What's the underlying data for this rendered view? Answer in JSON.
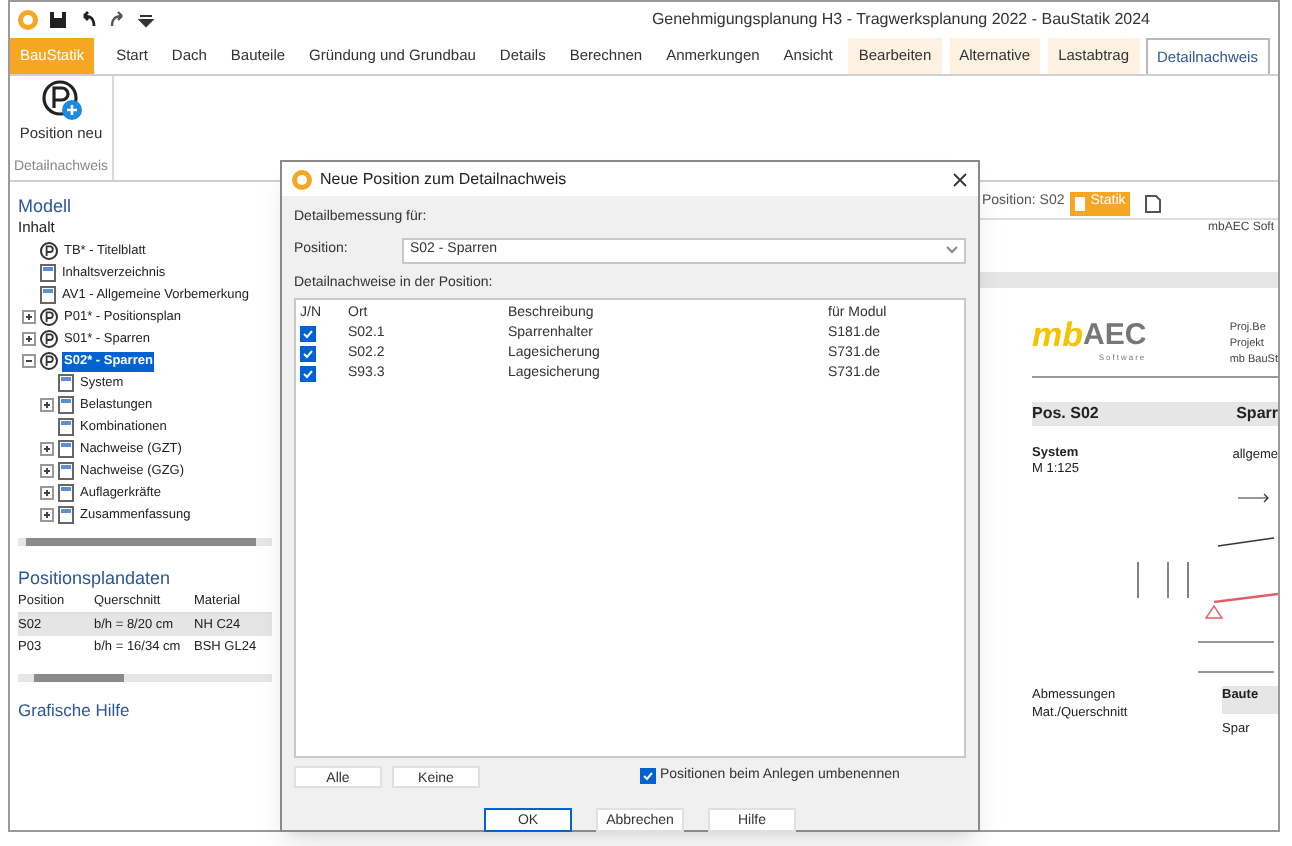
{
  "window": {
    "title": "Genehmigungsplanung H3 - Tragwerksplanung 2022 - BauStatik 2024"
  },
  "ribbon_tabs": [
    {
      "label": "BauStatik",
      "kind": "app",
      "selected": false
    },
    {
      "label": "Start",
      "kind": "normal",
      "selected": false
    },
    {
      "label": "Dach",
      "kind": "normal",
      "selected": false
    },
    {
      "label": "Bauteile",
      "kind": "normal",
      "selected": false
    },
    {
      "label": "Gründung und Grundbau",
      "kind": "normal",
      "selected": false
    },
    {
      "label": "Details",
      "kind": "normal",
      "selected": false
    },
    {
      "label": "Berechnen",
      "kind": "normal",
      "selected": false
    },
    {
      "label": "Anmerkungen",
      "kind": "normal",
      "selected": false
    },
    {
      "label": "Ansicht",
      "kind": "normal",
      "selected": false
    },
    {
      "label": "Bearbeiten",
      "kind": "contextual",
      "selected": false
    },
    {
      "label": "Alternative",
      "kind": "contextual",
      "selected": false
    },
    {
      "label": "Lastabtrag",
      "kind": "contextual",
      "selected": false
    },
    {
      "label": "Detailnachweis",
      "kind": "normal",
      "selected": true
    }
  ],
  "ribbon": {
    "buttons": [
      {
        "label": "Position neu"
      }
    ],
    "group_label": "Detailnachweis"
  },
  "model_panel": {
    "title": "Modell",
    "root": "Inhalt",
    "tree": [
      {
        "label": "TB* - Titelblatt",
        "kind": "position",
        "selected": false
      },
      {
        "label": "Inhaltsverzeichnis",
        "kind": "document",
        "selected": false
      },
      {
        "label": "AV1 - Allgemeine Vorbemerkung",
        "kind": "document",
        "selected": false
      },
      {
        "label": "P01* - Positionsplan",
        "kind": "position",
        "expanded": false,
        "selected": false
      },
      {
        "label": "S01* - Sparren",
        "kind": "position",
        "expanded": false,
        "selected": false
      },
      {
        "label": "S02* - Sparren",
        "kind": "position",
        "expanded": true,
        "selected": true,
        "children": [
          {
            "label": "System",
            "kind": "document",
            "selected": false
          },
          {
            "label": "Belastungen",
            "kind": "document",
            "expanded": false,
            "selected": false
          },
          {
            "label": "Kombinationen",
            "kind": "document",
            "selected": false
          },
          {
            "label": "Nachweise (GZT)",
            "kind": "document",
            "expanded": false,
            "selected": false
          },
          {
            "label": "Nachweise (GZG)",
            "kind": "document",
            "expanded": false,
            "selected": false
          },
          {
            "label": "Auflagerkräfte",
            "kind": "document",
            "expanded": false,
            "selected": false
          },
          {
            "label": "Zusammenfassung",
            "kind": "document",
            "expanded": false,
            "selected": false
          }
        ]
      }
    ]
  },
  "position_data": {
    "title": "Positionsplandaten",
    "columns": [
      "Position",
      "Querschnitt",
      "Material"
    ],
    "rows": [
      {
        "cells": [
          "S02",
          "b/h = 8/20 cm",
          "NH C24"
        ],
        "selected": true
      },
      {
        "cells": [
          "P03",
          "b/h = 16/34 cm",
          "BSH GL24"
        ],
        "selected": false
      }
    ]
  },
  "graphics_help": {
    "title": "Grafische Hilfe"
  },
  "document": {
    "position_label": "Position: S02",
    "tab": "Statik",
    "header_note": "mbAEC Soft",
    "logo": {
      "mark": "mb",
      "name": "AEC",
      "sub": "Software"
    },
    "project_lines": [
      "Proj.Be",
      "Projekt",
      "mb BauSt"
    ],
    "pos_title": "Pos. S02",
    "pos_desc": "Sparr",
    "system_label": "System",
    "scale": "M 1:125",
    "system_desc": "allgeme",
    "dim_labels": [
      "Abmessungen",
      "Mat./Querschnitt"
    ],
    "table_head": "Baute",
    "table_cell": "Spar"
  },
  "dialog": {
    "title": "Neue Position zum Detailnachweis",
    "section_label": "Detailbemessung für:",
    "position_label": "Position:",
    "position_value": "S02 - Sparren",
    "list_label": "Detailnachweise in der Position:",
    "check_column": "J/N",
    "columns": [
      "Ort",
      "Beschreibung",
      "für Modul"
    ],
    "rows": [
      {
        "checked": true,
        "cells": [
          "S02.1",
          "Sparrenhalter",
          "S181.de"
        ]
      },
      {
        "checked": true,
        "cells": [
          "S02.2",
          "Lagesicherung",
          "S731.de"
        ]
      },
      {
        "checked": true,
        "cells": [
          "S93.3",
          "Lagesicherung",
          "S731.de"
        ]
      }
    ],
    "select_buttons": [
      "Alle",
      "Keine"
    ],
    "rename_option": {
      "label": "Positionen beim Anlegen umbenennen",
      "checked": true
    },
    "buttons": [
      "OK",
      "Abbrechen",
      "Hilfe"
    ]
  }
}
